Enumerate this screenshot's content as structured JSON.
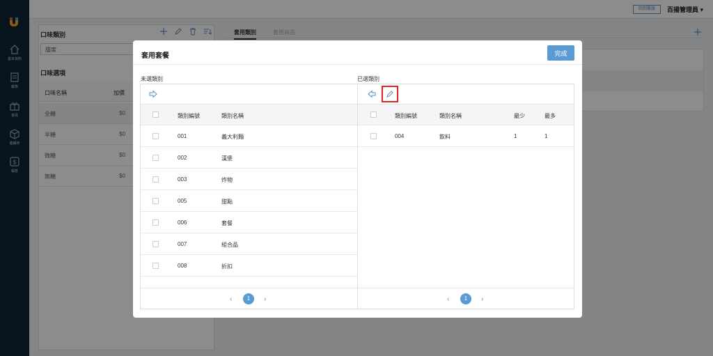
{
  "topbar": {
    "back_label": "回到舊版",
    "user_name": "百揚管理員 ▾"
  },
  "sidebar": {
    "items": [
      {
        "label": "基本資料",
        "icon": "home-icon"
      },
      {
        "label": "報表",
        "icon": "report-icon"
      },
      {
        "label": "會員",
        "icon": "gift-icon"
      },
      {
        "label": "進銷存",
        "icon": "box-icon"
      },
      {
        "label": "帳款",
        "icon": "dollar-icon"
      }
    ]
  },
  "background": {
    "flavor_category_title": "口味類別",
    "category_select_value": "甜度",
    "flavor_options_title": "口味選項",
    "col_name": "口味名稱",
    "col_price": "加價",
    "options": [
      {
        "name": "全糖",
        "price": "$0"
      },
      {
        "name": "半糖",
        "price": "$0"
      },
      {
        "name": "微糖",
        "price": "$0"
      },
      {
        "name": "無糖",
        "price": "$0"
      }
    ],
    "tabs": [
      "套用類別",
      "套用商品"
    ]
  },
  "modal": {
    "title": "套用套餐",
    "done_label": "完成",
    "left": {
      "section_label": "未選類別",
      "col_code": "類別編號",
      "col_name": "類別名稱",
      "rows": [
        {
          "code": "001",
          "name": "義大利麵"
        },
        {
          "code": "002",
          "name": "漢堡"
        },
        {
          "code": "003",
          "name": "炸物"
        },
        {
          "code": "005",
          "name": "甜點"
        },
        {
          "code": "006",
          "name": "套餐"
        },
        {
          "code": "007",
          "name": "組合品"
        },
        {
          "code": "008",
          "name": "折扣"
        }
      ],
      "page": "1"
    },
    "right": {
      "section_label": "已選類別",
      "col_code": "類別編號",
      "col_name": "類別名稱",
      "col_min": "最少",
      "col_max": "最多",
      "rows": [
        {
          "code": "004",
          "name": "飲料",
          "min": "1",
          "max": "1"
        }
      ],
      "page": "1"
    }
  },
  "colors": {
    "accent": "#5b9bd5",
    "sidebar": "#0e2638",
    "highlight": "#e02424"
  }
}
